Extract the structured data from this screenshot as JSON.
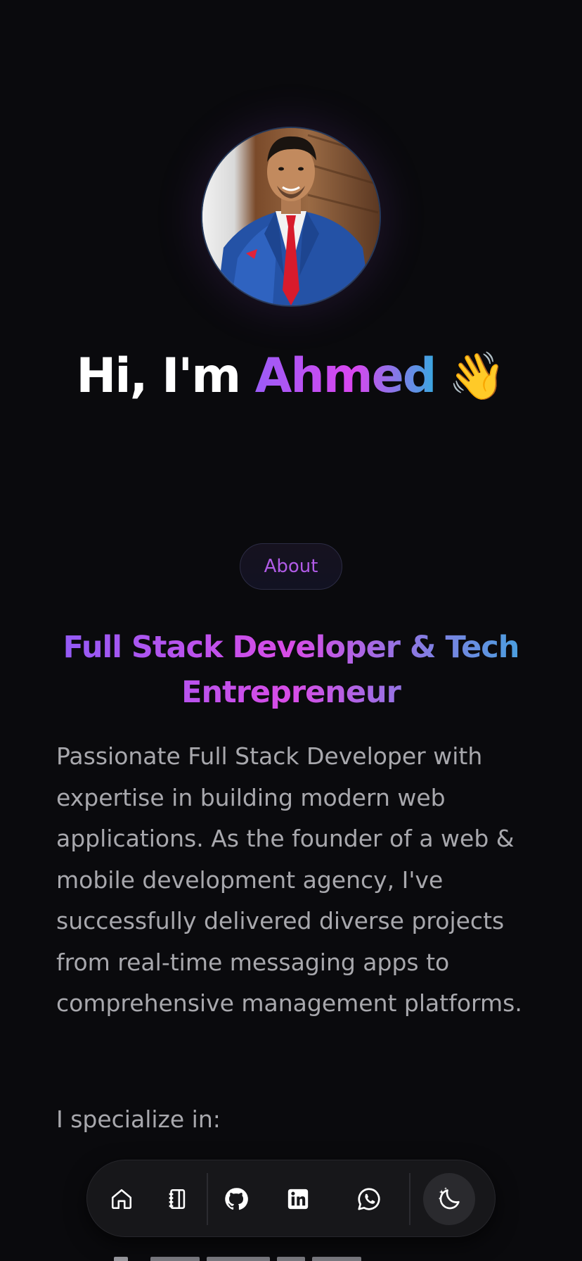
{
  "hero": {
    "greeting_prefix": "Hi, I'm ",
    "name": "Ahmed",
    "wave_emoji": "👋",
    "avatar_alt": "Ahmed profile photo"
  },
  "about": {
    "pill_label": "About",
    "headline": "Full Stack Developer & Tech Entrepreneur",
    "bio": "Passionate Full Stack Developer with expertise in building modern web applications. As the founder of a web & mobile development agency, I've successfully delivered diverse projects from real-time messaging apps to comprehensive management platforms.",
    "specialize_intro": "I specialize in:"
  },
  "dock": {
    "items": [
      {
        "icon": "home-icon"
      },
      {
        "icon": "notebook-icon"
      },
      {
        "icon": "github-icon"
      },
      {
        "icon": "linkedin-icon"
      },
      {
        "icon": "whatsapp-icon"
      },
      {
        "icon": "moon-stars-icon"
      }
    ]
  },
  "colors": {
    "background": "#0a0a0d",
    "accent_purple": "#9b5cf6",
    "accent_magenta": "#d946ef",
    "accent_blue": "#38a8e0",
    "body_text": "#a8a8ad"
  }
}
